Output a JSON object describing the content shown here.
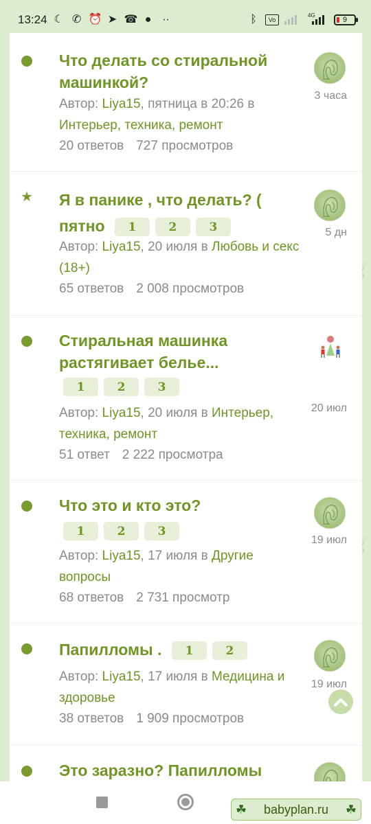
{
  "status_bar": {
    "time": "13:24",
    "network": "4G",
    "battery": "9"
  },
  "topics": [
    {
      "marker": "dot",
      "title": "Что делать со стиральной машинкой?",
      "pages": [],
      "author_prefix": "Автор: ",
      "author": "Liya15",
      "date_text": ", пятница в 20:26 в",
      "category": "Интерьер, техника, ремонт",
      "replies": "20 ответов",
      "views": "727 просмотров",
      "ago": "3 часа",
      "avatar": "woman-avatar"
    },
    {
      "marker": "star",
      "title": "Я в панике , что делать? ( пятно",
      "pages": [
        "1",
        "2",
        "3"
      ],
      "author_prefix": "Автор: ",
      "author": "Liya15",
      "date_text": ", 20 июля в ",
      "category": "Любовь и секс (18+)",
      "replies": "65 ответов",
      "views": "2 008 просмотров",
      "ago": "5 дн",
      "avatar": "woman-avatar"
    },
    {
      "marker": "dot",
      "title": "Стиральная машинка растягивает белье...",
      "pages": [
        "1",
        "2",
        "3"
      ],
      "author_prefix": "Автор: ",
      "author": "Liya15",
      "date_text": ", 20 июля в ",
      "category": "Интерьер, техника, ремонт",
      "replies": "51 ответ",
      "views": "2 222 просмотра",
      "ago": "20 июл",
      "avatar": "kids-avatar"
    },
    {
      "marker": "dot",
      "title": "Что это и кто это?",
      "pages": [
        "1",
        "2",
        "3"
      ],
      "author_prefix": "Автор: ",
      "author": "Liya15",
      "date_text": ", 17 июля в ",
      "category": "Другие вопросы",
      "replies": "68 ответов",
      "views": "2 731 просмотр",
      "ago": "19 июл",
      "avatar": "woman-avatar"
    },
    {
      "marker": "dot",
      "title": "Папилломы .",
      "pages": [
        "1",
        "2"
      ],
      "author_prefix": "Автор: ",
      "author": "Liya15",
      "date_text": ", 17 июля в ",
      "category": "Медицина и здоровье",
      "replies": "38 ответов",
      "views": "1 909 просмотров",
      "ago": "19 июл",
      "avatar": "woman-avatar"
    },
    {
      "marker": "dot",
      "title": "Это заразно? Папилломы",
      "pages": [],
      "author_prefix": "",
      "author": "",
      "date_text": "",
      "category": "",
      "replies": "",
      "views": "",
      "ago": "",
      "avatar": "woman-avatar"
    }
  ],
  "brand": {
    "label": "babyplan.ru"
  }
}
